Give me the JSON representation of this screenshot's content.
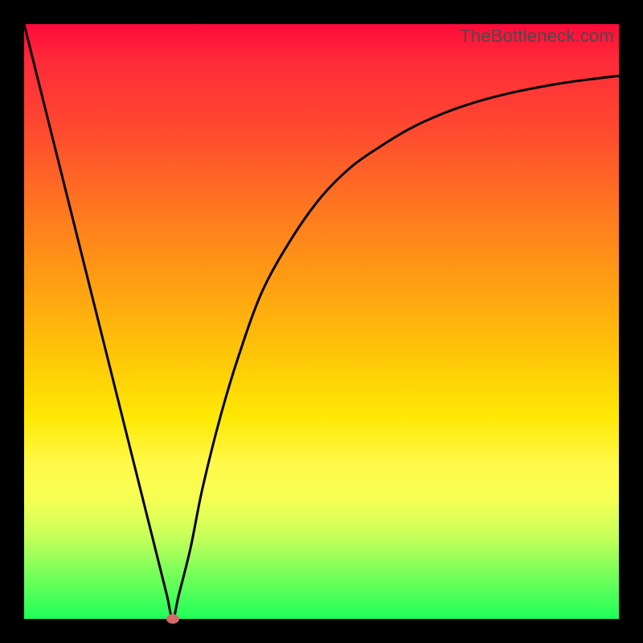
{
  "watermark": "TheBottleneck.com",
  "colors": {
    "curve_stroke": "#000000",
    "marker_fill": "#d46a6a",
    "frame_bg": "#000000"
  },
  "chart_data": {
    "type": "line",
    "title": "",
    "xlabel": "",
    "ylabel": "",
    "xlim": [
      0,
      100
    ],
    "ylim": [
      0,
      100
    ],
    "grid": false,
    "legend": false,
    "annotations": [],
    "series": [
      {
        "name": "bottleneck-curve",
        "x": [
          0,
          2,
          5,
          8,
          11,
          14,
          17,
          20,
          23,
          24,
          25,
          26,
          28,
          30,
          33,
          36,
          40,
          45,
          50,
          55,
          60,
          65,
          70,
          75,
          80,
          85,
          90,
          95,
          100
        ],
        "y": [
          100,
          92,
          80,
          68,
          56,
          44,
          32,
          20,
          8,
          4,
          0,
          4,
          12,
          22,
          34,
          44,
          55,
          64,
          71,
          76,
          79.5,
          82.5,
          84.8,
          86.6,
          88,
          89.1,
          90,
          90.7,
          91.3
        ]
      }
    ],
    "marker": {
      "x": 25,
      "y": 0
    }
  }
}
